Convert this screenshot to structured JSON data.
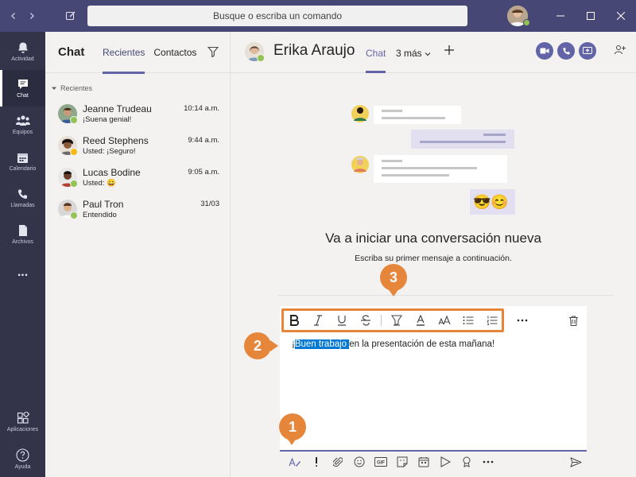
{
  "titlebar": {
    "search_placeholder": "Busque o escriba un comando",
    "back_icon": "chevron-left-icon",
    "forward_icon": "chevron-right-icon",
    "compose_icon": "compose-icon"
  },
  "rail": {
    "items": [
      {
        "label": "Actividad",
        "icon": "bell-icon"
      },
      {
        "label": "Chat",
        "icon": "chat-icon",
        "active": true
      },
      {
        "label": "Equipos",
        "icon": "teams-icon"
      },
      {
        "label": "Calendario",
        "icon": "calendar-icon"
      },
      {
        "label": "Llamadas",
        "icon": "phone-icon"
      },
      {
        "label": "Archivos",
        "icon": "file-icon"
      },
      {
        "label": "...",
        "icon": "more-icon"
      },
      {
        "label": "Aplicaciones",
        "icon": "apps-icon"
      },
      {
        "label": "Ayuda",
        "icon": "help-icon"
      }
    ]
  },
  "chatlist": {
    "title": "Chat",
    "tabs": [
      "Recientes",
      "Contactos"
    ],
    "section": "Recientes",
    "items": [
      {
        "name": "Jeanne Trudeau",
        "message": "¡Suena genial!",
        "time": "10:14 a.m.",
        "status": "#92c353"
      },
      {
        "name": "Reed Stephens",
        "message": "Usted: ¡Seguro!",
        "time": "9:44 a.m.",
        "status": "#fdb913"
      },
      {
        "name": "Lucas Bodine",
        "message": "Usted: 😀",
        "time": "9:05 a.m.",
        "status": "#92c353"
      },
      {
        "name": "Paul Tron",
        "message": "Entendido",
        "time": "31/03",
        "status": "#92c353"
      }
    ]
  },
  "main": {
    "contact_name": "Erika Araujo",
    "tab_chat": "Chat",
    "tab_more": "3 más",
    "empty_title": "Va a iniciar una conversación nueva",
    "empty_subtitle": "Escriba su primer mensaje a continuación.",
    "compose": {
      "text_pre": "¡",
      "text_selected": "Buen trabajo ",
      "text_post": "en la presentación de esta mañana!"
    },
    "format_buttons": [
      "bold-icon",
      "italic-icon",
      "underline-icon",
      "strikethrough-icon",
      "highlight-icon",
      "font-color-icon",
      "font-size-icon",
      "bullet-list-icon",
      "numbered-list-icon"
    ],
    "illustration_emoji": "😎😊"
  },
  "callouts": [
    "1",
    "2",
    "3"
  ],
  "colors": {
    "accent": "#6264a7",
    "titlebar": "#464775",
    "rail": "#33344a",
    "callout": "#e6863a",
    "selection": "#0078d4"
  }
}
